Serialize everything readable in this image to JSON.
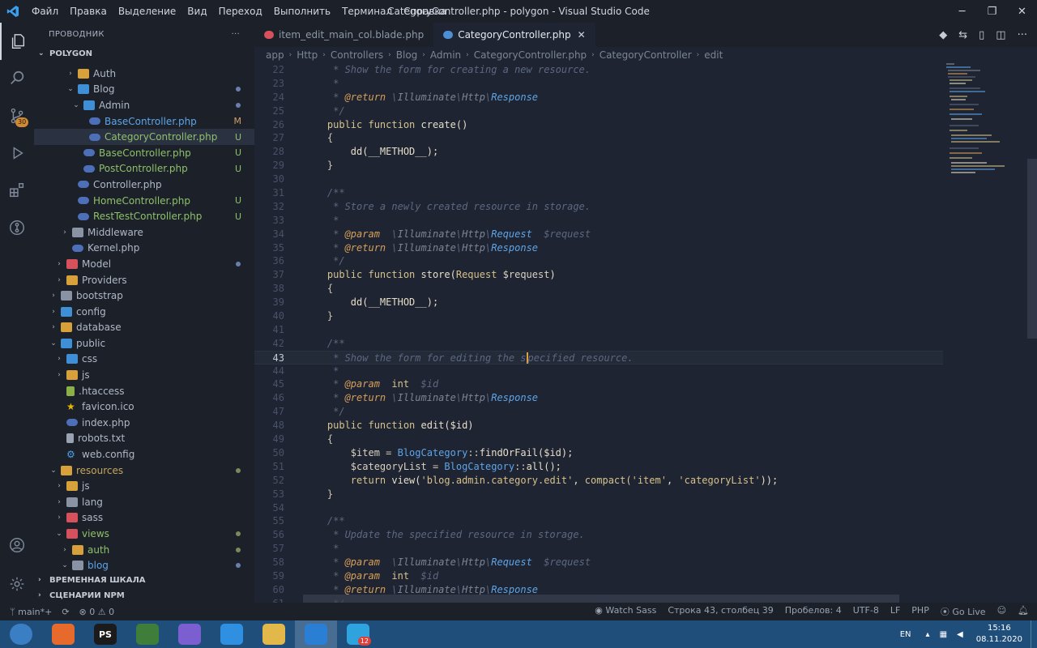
{
  "window": {
    "title": "CategoryController.php - polygon - Visual Studio Code",
    "menu": [
      "Файл",
      "Правка",
      "Выделение",
      "Вид",
      "Переход",
      "Выполнить",
      "Терминал",
      "Справка"
    ]
  },
  "activity": {
    "scm_badge": "30"
  },
  "sidebar": {
    "header": "ПРОВОДНИК",
    "more": "···",
    "root": "POLYGON",
    "items": [
      {
        "label": "Auth",
        "indent": 3,
        "icon": "folder",
        "chev": "›"
      },
      {
        "label": "Blog",
        "indent": 3,
        "icon": "folder-blue",
        "chev": "⌄",
        "dot": "#6a7fb0"
      },
      {
        "label": "Admin",
        "indent": 4,
        "icon": "folder-blue",
        "chev": "⌄",
        "dot": "#6a7fb0"
      },
      {
        "label": "BaseController.php",
        "indent": 5,
        "icon": "php",
        "status": "M",
        "color": "#5ea5e8",
        "status_color": "#d0a066"
      },
      {
        "label": "CategoryController.php",
        "indent": 5,
        "icon": "php",
        "status": "U",
        "color": "#8fc06a",
        "status_color": "#8fc06a",
        "active": true
      },
      {
        "label": "BaseController.php",
        "indent": 4,
        "icon": "php",
        "status": "U",
        "color": "#8fc06a",
        "status_color": "#8fc06a"
      },
      {
        "label": "PostController.php",
        "indent": 4,
        "icon": "php",
        "status": "U",
        "color": "#8fc06a",
        "status_color": "#8fc06a"
      },
      {
        "label": "Controller.php",
        "indent": 3,
        "icon": "php"
      },
      {
        "label": "HomeController.php",
        "indent": 3,
        "icon": "php",
        "status": "U",
        "color": "#8fc06a",
        "status_color": "#8fc06a"
      },
      {
        "label": "RestTestController.php",
        "indent": 3,
        "icon": "php",
        "status": "U",
        "color": "#8fc06a",
        "status_color": "#8fc06a"
      },
      {
        "label": "Middleware",
        "indent": 2,
        "icon": "folder-plain",
        "chev": "›"
      },
      {
        "label": "Kernel.php",
        "indent": 2,
        "icon": "php"
      },
      {
        "label": "Model",
        "indent": 1,
        "icon": "folder-red",
        "chev": "›",
        "dot": "#6a7fb0"
      },
      {
        "label": "Providers",
        "indent": 1,
        "icon": "folder",
        "chev": "›"
      },
      {
        "label": "bootstrap",
        "indent": 0,
        "icon": "folder-plain",
        "chev": "›"
      },
      {
        "label": "config",
        "indent": 0,
        "icon": "folder-blue",
        "chev": "›"
      },
      {
        "label": "database",
        "indent": 0,
        "icon": "folder",
        "chev": "›"
      },
      {
        "label": "public",
        "indent": 0,
        "icon": "folder-blue",
        "chev": "⌄"
      },
      {
        "label": "css",
        "indent": 1,
        "icon": "folder-blue",
        "chev": "›"
      },
      {
        "label": "js",
        "indent": 1,
        "icon": "folder",
        "chev": "›"
      },
      {
        "label": ".htaccess",
        "indent": 1,
        "icon": "htac"
      },
      {
        "label": "favicon.ico",
        "indent": 1,
        "icon": "star"
      },
      {
        "label": "index.php",
        "indent": 1,
        "icon": "php"
      },
      {
        "label": "robots.txt",
        "indent": 1,
        "icon": "file"
      },
      {
        "label": "web.config",
        "indent": 1,
        "icon": "gear"
      },
      {
        "label": "resources",
        "indent": 0,
        "icon": "folder",
        "chev": "⌄",
        "dot": "#7a8a5a",
        "color": "#c7a45c"
      },
      {
        "label": "js",
        "indent": 1,
        "icon": "folder",
        "chev": "›"
      },
      {
        "label": "lang",
        "indent": 1,
        "icon": "folder-plain",
        "chev": "›"
      },
      {
        "label": "sass",
        "indent": 1,
        "icon": "folder-red",
        "chev": "›"
      },
      {
        "label": "views",
        "indent": 1,
        "icon": "folder-red",
        "chev": "⌄",
        "dot": "#7a8a5a",
        "color": "#8fc06a"
      },
      {
        "label": "auth",
        "indent": 2,
        "icon": "folder",
        "chev": "›",
        "dot": "#7a8a5a",
        "color": "#8fc06a"
      },
      {
        "label": "blog",
        "indent": 2,
        "icon": "folder-plain",
        "chev": "⌄",
        "dot": "#6a7fb0",
        "color": "#5ea5e8"
      }
    ],
    "sections": [
      "ВРЕМЕННАЯ ШКАЛА",
      "СЦЕНАРИИ NPM"
    ]
  },
  "tabs": [
    {
      "label": "item_edit_main_col.blade.php",
      "active": false,
      "icon_color": "#d6515c"
    },
    {
      "label": "CategoryController.php",
      "active": true,
      "icon_color": "#4d8fd6"
    }
  ],
  "breadcrumb": [
    "app",
    "Http",
    "Controllers",
    "Blog",
    "Admin",
    "CategoryController.php",
    "CategoryController",
    "edit"
  ],
  "code": {
    "current_line": 43,
    "lines": [
      {
        "n": 22,
        "t": [
          [
            "c-com",
            "     * Show the form for creating a new resource."
          ]
        ]
      },
      {
        "n": 23,
        "t": [
          [
            "c-com",
            "     *"
          ]
        ]
      },
      {
        "n": 24,
        "t": [
          [
            "c-com",
            "     * "
          ],
          [
            "c-tag",
            "@return"
          ],
          [
            "c-com",
            " \\"
          ],
          [
            "c-dim",
            "Illuminate"
          ],
          [
            "c-com",
            "\\"
          ],
          [
            "c-dim",
            "Http"
          ],
          [
            "c-com",
            "\\"
          ],
          [
            "c-cls",
            "Response"
          ]
        ]
      },
      {
        "n": 25,
        "t": [
          [
            "c-com",
            "     */"
          ]
        ]
      },
      {
        "n": 26,
        "t": [
          [
            "c-kw",
            "    public function "
          ],
          [
            "c-fn",
            "create()"
          ]
        ]
      },
      {
        "n": 27,
        "t": [
          [
            "c-pl",
            "    {"
          ]
        ]
      },
      {
        "n": 28,
        "t": [
          [
            "c-fn",
            "        dd(__METHOD__);"
          ]
        ]
      },
      {
        "n": 29,
        "t": [
          [
            "c-pl",
            "    }"
          ]
        ]
      },
      {
        "n": 30,
        "t": [
          [
            "c-pl",
            ""
          ]
        ]
      },
      {
        "n": 31,
        "t": [
          [
            "c-com",
            "    /**"
          ]
        ]
      },
      {
        "n": 32,
        "t": [
          [
            "c-com",
            "     * Store a newly created resource in storage."
          ]
        ]
      },
      {
        "n": 33,
        "t": [
          [
            "c-com",
            "     *"
          ]
        ]
      },
      {
        "n": 34,
        "t": [
          [
            "c-com",
            "     * "
          ],
          [
            "c-tag",
            "@param"
          ],
          [
            "c-com",
            "  \\"
          ],
          [
            "c-dim",
            "Illuminate"
          ],
          [
            "c-com",
            "\\"
          ],
          [
            "c-dim",
            "Http"
          ],
          [
            "c-com",
            "\\"
          ],
          [
            "c-cls",
            "Request"
          ],
          [
            "c-com",
            "  $request"
          ]
        ]
      },
      {
        "n": 35,
        "t": [
          [
            "c-com",
            "     * "
          ],
          [
            "c-tag",
            "@return"
          ],
          [
            "c-com",
            " \\"
          ],
          [
            "c-dim",
            "Illuminate"
          ],
          [
            "c-com",
            "\\"
          ],
          [
            "c-dim",
            "Http"
          ],
          [
            "c-com",
            "\\"
          ],
          [
            "c-cls",
            "Response"
          ]
        ]
      },
      {
        "n": 36,
        "t": [
          [
            "c-com",
            "     */"
          ]
        ]
      },
      {
        "n": 37,
        "t": [
          [
            "c-kw",
            "    public function "
          ],
          [
            "c-fn",
            "store("
          ],
          [
            "c-str",
            "Request"
          ],
          [
            "c-var",
            " $request"
          ],
          [
            "c-fn",
            ")"
          ]
        ]
      },
      {
        "n": 38,
        "t": [
          [
            "c-pl",
            "    {"
          ]
        ]
      },
      {
        "n": 39,
        "t": [
          [
            "c-fn",
            "        dd(__METHOD__);"
          ]
        ]
      },
      {
        "n": 40,
        "t": [
          [
            "c-pl",
            "    }"
          ]
        ]
      },
      {
        "n": 41,
        "t": [
          [
            "c-pl",
            ""
          ]
        ]
      },
      {
        "n": 42,
        "t": [
          [
            "c-com",
            "    /**"
          ]
        ]
      },
      {
        "n": 43,
        "t": [
          [
            "c-com",
            "     * Show the form for editing the s"
          ],
          [
            "caret",
            ""
          ],
          [
            "c-com",
            "pecified resource."
          ]
        ]
      },
      {
        "n": 44,
        "t": [
          [
            "c-com",
            "     *"
          ]
        ]
      },
      {
        "n": 45,
        "t": [
          [
            "c-com",
            "     * "
          ],
          [
            "c-tag",
            "@param"
          ],
          [
            "c-com",
            "  "
          ],
          [
            "c-kw",
            "int"
          ],
          [
            "c-com",
            "  $id"
          ]
        ]
      },
      {
        "n": 46,
        "t": [
          [
            "c-com",
            "     * "
          ],
          [
            "c-tag",
            "@return"
          ],
          [
            "c-com",
            " \\"
          ],
          [
            "c-dim",
            "Illuminate"
          ],
          [
            "c-com",
            "\\"
          ],
          [
            "c-dim",
            "Http"
          ],
          [
            "c-com",
            "\\"
          ],
          [
            "c-cls",
            "Response"
          ]
        ]
      },
      {
        "n": 47,
        "t": [
          [
            "c-com",
            "     */"
          ]
        ]
      },
      {
        "n": 48,
        "t": [
          [
            "c-kw",
            "    public function "
          ],
          [
            "c-fn",
            "edit($id)"
          ]
        ]
      },
      {
        "n": 49,
        "t": [
          [
            "c-pl",
            "    {"
          ]
        ]
      },
      {
        "n": 50,
        "t": [
          [
            "c-var",
            "        $item"
          ],
          [
            "c-pl",
            " = "
          ],
          [
            "c-type",
            "BlogCategory"
          ],
          [
            "c-pl",
            "::"
          ],
          [
            "c-fn",
            "findOrFail($id);"
          ]
        ]
      },
      {
        "n": 51,
        "t": [
          [
            "c-var",
            "        $categoryList"
          ],
          [
            "c-pl",
            " = "
          ],
          [
            "c-type",
            "BlogCategory"
          ],
          [
            "c-pl",
            "::"
          ],
          [
            "c-fn",
            "all();"
          ]
        ]
      },
      {
        "n": 52,
        "t": [
          [
            "c-kw",
            "        return "
          ],
          [
            "c-fn",
            "view("
          ],
          [
            "c-str",
            "'blog.admin.category.edit'"
          ],
          [
            "c-fn",
            ", "
          ],
          [
            "c-kw",
            "compact("
          ],
          [
            "c-str",
            "'item'"
          ],
          [
            "c-fn",
            ", "
          ],
          [
            "c-str",
            "'categoryList'"
          ],
          [
            "c-fn",
            "));"
          ]
        ]
      },
      {
        "n": 53,
        "t": [
          [
            "c-pl",
            "    }"
          ]
        ]
      },
      {
        "n": 54,
        "t": [
          [
            "c-pl",
            ""
          ]
        ]
      },
      {
        "n": 55,
        "t": [
          [
            "c-com",
            "    /**"
          ]
        ]
      },
      {
        "n": 56,
        "t": [
          [
            "c-com",
            "     * Update the specified resource in storage."
          ]
        ]
      },
      {
        "n": 57,
        "t": [
          [
            "c-com",
            "     *"
          ]
        ]
      },
      {
        "n": 58,
        "t": [
          [
            "c-com",
            "     * "
          ],
          [
            "c-tag",
            "@param"
          ],
          [
            "c-com",
            "  \\"
          ],
          [
            "c-dim",
            "Illuminate"
          ],
          [
            "c-com",
            "\\"
          ],
          [
            "c-dim",
            "Http"
          ],
          [
            "c-com",
            "\\"
          ],
          [
            "c-cls",
            "Request"
          ],
          [
            "c-com",
            "  $request"
          ]
        ]
      },
      {
        "n": 59,
        "t": [
          [
            "c-com",
            "     * "
          ],
          [
            "c-tag",
            "@param"
          ],
          [
            "c-com",
            "  "
          ],
          [
            "c-kw",
            "int"
          ],
          [
            "c-com",
            "  $id"
          ]
        ]
      },
      {
        "n": 60,
        "t": [
          [
            "c-com",
            "     * "
          ],
          [
            "c-tag",
            "@return"
          ],
          [
            "c-com",
            " \\"
          ],
          [
            "c-dim",
            "Illuminate"
          ],
          [
            "c-com",
            "\\"
          ],
          [
            "c-dim",
            "Http"
          ],
          [
            "c-com",
            "\\"
          ],
          [
            "c-cls",
            "Response"
          ]
        ]
      },
      {
        "n": 61,
        "t": [
          [
            "c-com",
            "     */"
          ]
        ]
      }
    ]
  },
  "statusbar": {
    "branch": "main*+",
    "sync": "⟳",
    "problems": "⊗ 0 ⚠ 0",
    "watch": "Watch Sass",
    "position": "Строка 43, столбец 39",
    "spaces": "Пробелов: 4",
    "encoding": "UTF-8",
    "eol": "LF",
    "language": "PHP",
    "golive": "Go Live"
  },
  "taskbar": {
    "apps": [
      {
        "name": "start-button",
        "label": "",
        "color": "#3a7fc4"
      },
      {
        "name": "firefox-app",
        "label": "",
        "color": "#e66a2c"
      },
      {
        "name": "phpstorm-app",
        "label": "PS",
        "color": "#1b1b1b"
      },
      {
        "name": "editor-app",
        "label": "",
        "color": "#3f7d3a"
      },
      {
        "name": "discord-app",
        "label": "",
        "color": "#7b5fd1"
      },
      {
        "name": "browser-app",
        "label": "",
        "color": "#2f8fe0"
      },
      {
        "name": "explorer-app",
        "label": "",
        "color": "#e2b84a"
      },
      {
        "name": "vscode-app",
        "label": "",
        "color": "#2a7fd4",
        "active": true
      },
      {
        "name": "telegram-app",
        "label": "",
        "color": "#2fa3de",
        "badge": "12"
      }
    ],
    "lang": "EN",
    "time": "15:16",
    "date": "08.11.2020"
  }
}
